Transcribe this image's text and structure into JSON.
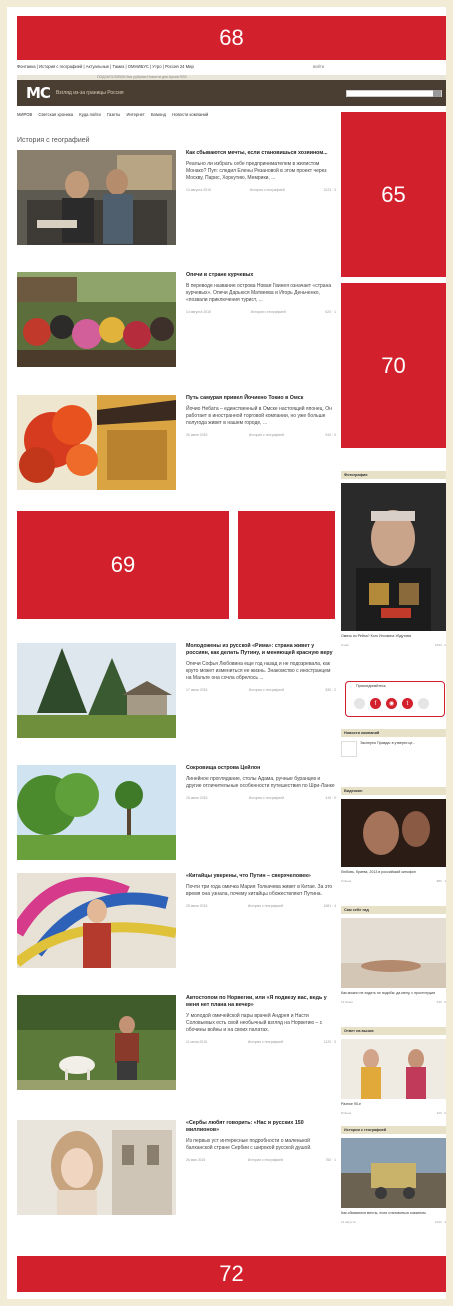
{
  "ads": {
    "top": "68",
    "side_top": "65",
    "side_mid": "70",
    "inline": "69",
    "bottom": "72"
  },
  "top_links": "Фонтанка | История с географией | Актуальные | Тамиз | ОМНИБУС | Утро | Россия 24 Мир",
  "top_links_right": "войти",
  "topbar": "ПОДЗАГОЛОВОК    Все рубрики    Новости дня    Архив    RSS",
  "header": {
    "logo": "МС",
    "tagline": "Взгляд из-за границы Россия",
    "search_placeholder": ""
  },
  "subnav": [
    "МИРОВ",
    "Светская хроника",
    "Куда пойти",
    "Газеты",
    "Интернет",
    "Бомонд",
    "Новости компаний"
  ],
  "section_title": "История с географией",
  "articles": [
    {
      "title": "Как сбываются мечты, если становишься хозяином...",
      "desc": "Реально ли избрать себе предпринимателем в жилистом Монако? Пуп: следил Елены Резановой в этом проект через Москву, Парис, Хоркутию, Мемрики, ...",
      "date": "14 августа 2015",
      "rubric": "История с географией",
      "stats": "1023 · 3"
    },
    {
      "title": "Опечи в стране курчевых",
      "desc": "В переводе название острова Новая Гвинея означает «страна курчевых». Опечи Дарьюся Матвеева и Игорь Деньченко, «позвали приключения турист, ...",
      "date": "14 августа 2015",
      "rubric": "История с географией",
      "stats": "620 · 1"
    },
    {
      "title": "Путь самурая привел Йочиено Токио в Омск",
      "desc": "Йочио Небата – единственный в Омске настоящий японец. Он работает в иностранной торговой компании, но уже больше полугода живет в нашем городе, ...",
      "date": "26 июля 2015",
      "rubric": "История с географией",
      "stats": "510 · 0"
    },
    {
      "title": "Молодожены из русской «Рима»: страна живет у россиян, как делать Путину, и меняющей красную веру",
      "desc": "Опечи Софья Любовина еще год назад и не подозревала, как круто может измениться ее жизнь. Знакомство с иностранцем на Мальте она сочла обрелось ...",
      "date": "17 июля 2015",
      "rubric": "История с географией",
      "stats": "830 · 2"
    },
    {
      "title": "Сокровища острова Цейлон",
      "desc": "Линейное проглядание, столы Адама, ручные буранцев и другие отличительные особенности путешествия по Шри-Ланке",
      "date": "15 июля 2015",
      "rubric": "История с географией",
      "stats": "415 · 0"
    },
    {
      "title": "«Китайцы уверены, что Путин – сверхчеловек»",
      "desc": "Почти три года омичка Мария Толкачева живет в Китае. За это время она узнала, почему китайцы обожествляют Путина.",
      "date": "25 июня 2015",
      "rubric": "История с географией",
      "stats": "1081 · 4"
    },
    {
      "title": "Автостопом по Норвегии, или «Я подвезу вас, ведь у меня нет плана на вечер»",
      "desc": "У молодой омичейской пары врачей Андрея и Насти Соловьевых есть свой необычный взгляд на Норвегию – с обочины войны и на своих палатах.",
      "date": "11 июня 2015",
      "rubric": "История с географией",
      "stats": "1120 · 3"
    },
    {
      "title": "«Сербы любят говорить: «Нас и русских 150 миллионов»",
      "desc": "Из первых уст интересные подробности о маленькой балканской стране Сербии с широкой русской душой.",
      "date": "26 мая 2015",
      "rubric": "История с географией",
      "stats": "760 · 1"
    }
  ],
  "sidebar": {
    "photo_title": "Фотография",
    "photo_caption": "Омичь из Рейха? Кого Иголкина Уйдутова",
    "photo_meta_date": "9 мая",
    "photo_meta_stats": "1534 · 2",
    "share_label": "Присоединяйтесь",
    "news_title": "Новости компаний",
    "news_item": "Эксперты Правда: в утверти це...",
    "video_title": "Видеокон",
    "video_caption": "Любовь, братва, 2013 в российский кинофон",
    "video_meta_date": "6 Июня",
    "video_meta_stats": "880 · 1",
    "travel_title": "Сам себе гид",
    "travel_caption": "Как можно не ходить по подобы: да мелу, с проституции",
    "travel_meta_date": "12 Июня",
    "travel_meta_stats": "540 · 0",
    "people_title": "Ответ на вызов",
    "people_caption": "Разное 90-е",
    "people_meta_date": "8 Июня",
    "people_meta_stats": "320 · 0",
    "history_title": "История с географией",
    "history_caption": "Как сбываются мечты, если становиться хозяином",
    "history_meta_date": "14 августа",
    "history_meta_stats": "1023 · 3"
  },
  "colors": {
    "ad_red": "#d3202d",
    "header_brown": "#4a3e32",
    "page_bg": "#f2ecd6",
    "sidebar_header": "#e7e1c8"
  }
}
